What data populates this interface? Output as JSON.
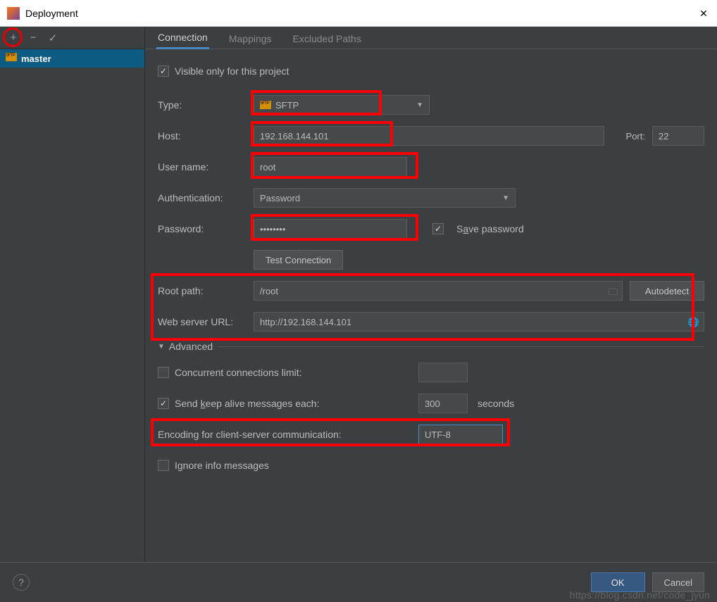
{
  "window": {
    "title": "Deployment"
  },
  "sidebar": {
    "server_name": "master"
  },
  "tabs": {
    "connection": "Connection",
    "mappings": "Mappings",
    "excluded": "Excluded Paths"
  },
  "form": {
    "visible_only_label": "Visible only for this project",
    "visible_only_checked": true,
    "type_label": "Type:",
    "type_value": "SFTP",
    "host_label": "Host:",
    "host_value": "192.168.144.101",
    "port_label": "Port:",
    "port_value": "22",
    "user_label": "User name:",
    "user_value": "root",
    "auth_label": "Authentication:",
    "auth_value": "Password",
    "password_label": "Password:",
    "password_value": "••••••••",
    "save_password_label_prefix": "S",
    "save_password_label_rest": "ve password",
    "save_password_underlined": "a",
    "save_password_checked": true,
    "test_connection_label": "Test Connection",
    "root_path_label": "Root path:",
    "root_path_value": "/root",
    "autodetect_label": "Autodetect",
    "web_url_label": "Web server URL:",
    "web_url_value": "http://192.168.144.101",
    "advanced_label": "Advanced",
    "concurrent_label": "Concurrent connections limit:",
    "concurrent_checked": false,
    "keepalive_prefix": "Send ",
    "keepalive_underlined": "k",
    "keepalive_rest": "eep alive messages each:",
    "keepalive_value": "300",
    "keepalive_checked": true,
    "seconds_label": "seconds",
    "encoding_label": "Encoding for client-server communication:",
    "encoding_value": "UTF-8",
    "ignore_info_label": "Ignore info messages",
    "ignore_info_checked": false
  },
  "footer": {
    "ok_label": "OK",
    "cancel_label": "Cancel"
  },
  "watermark": "https://blog.csdn.net/code_jyun"
}
